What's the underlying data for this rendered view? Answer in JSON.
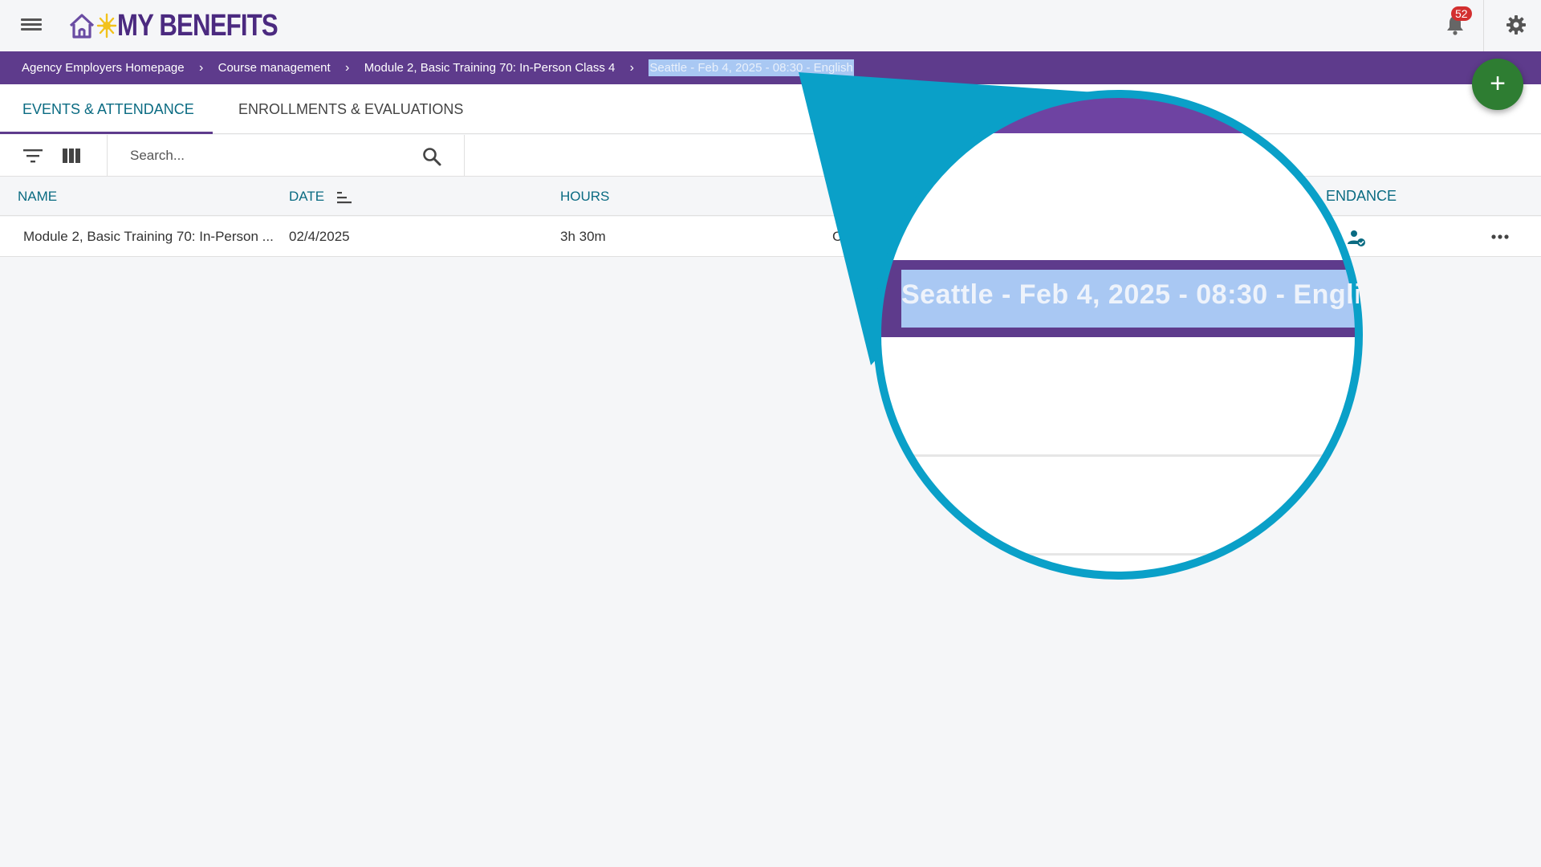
{
  "app": {
    "logo_text": "MY BENEFITS",
    "notification_count": "52",
    "colors": {
      "brand_purple": "#5e3b8c",
      "accent_teal": "#0a6b82",
      "fab_green": "#2e7d32",
      "badge_red": "#d32f2f",
      "magnifier_blue": "#0aa0c8"
    }
  },
  "breadcrumb": {
    "items": [
      "Agency Employers Homepage",
      "Course management",
      "Module 2, Basic Training 70: In-Person Class 4"
    ],
    "current": "Seattle - Feb 4, 2025 - 08:30 - English",
    "separator": "›"
  },
  "tabs": [
    {
      "label": "EVENTS & ATTENDANCE",
      "active": true
    },
    {
      "label": "ENROLLMENTS & EVALUATIONS",
      "active": false
    }
  ],
  "toolbar": {
    "search_placeholder": "Search..."
  },
  "table": {
    "columns": [
      "NAME",
      "DATE",
      "HOURS",
      "ATTENDANCE"
    ],
    "rows": [
      {
        "name": "Module 2, Basic Training 70: In-Person ...",
        "date": "02/4/2025",
        "hours": "3h 30m",
        "peek": "C"
      }
    ]
  },
  "magnifier": {
    "zoomed_text": "Seattle - Feb 4, 2025 - 08:30 - Engli",
    "zoomed_header_peek": "ENDANCE"
  },
  "fab": {
    "label": "+"
  }
}
